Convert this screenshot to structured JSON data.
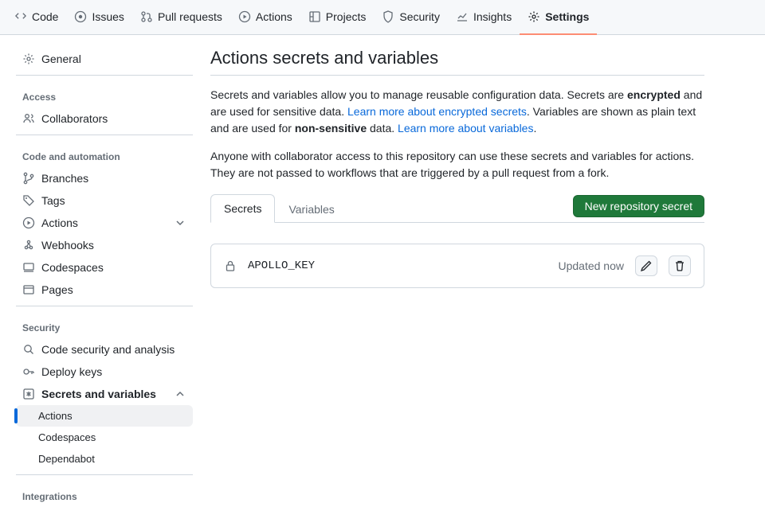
{
  "topnav": [
    {
      "label": "Code",
      "icon": "code"
    },
    {
      "label": "Issues",
      "icon": "issue"
    },
    {
      "label": "Pull requests",
      "icon": "pr"
    },
    {
      "label": "Actions",
      "icon": "play"
    },
    {
      "label": "Projects",
      "icon": "project"
    },
    {
      "label": "Security",
      "icon": "shield"
    },
    {
      "label": "Insights",
      "icon": "graph"
    },
    {
      "label": "Settings",
      "icon": "gear",
      "active": true
    }
  ],
  "sidebar": {
    "general": "General",
    "access_heading": "Access",
    "collaborators": "Collaborators",
    "code_heading": "Code and automation",
    "branches": "Branches",
    "tags": "Tags",
    "actions": "Actions",
    "webhooks": "Webhooks",
    "codespaces": "Codespaces",
    "pages": "Pages",
    "security_heading": "Security",
    "codesec": "Code security and analysis",
    "deploy": "Deploy keys",
    "secrets": "Secrets and variables",
    "sv_actions": "Actions",
    "sv_codespaces": "Codespaces",
    "sv_dependabot": "Dependabot",
    "integrations_heading": "Integrations"
  },
  "page": {
    "title": "Actions secrets and variables",
    "p1a": "Secrets and variables allow you to manage reusable configuration data. Secrets are ",
    "p1b": "encrypted",
    "p1c": " and are used for sensitive data. ",
    "p1link1": "Learn more about encrypted secrets",
    "p1d": ". Variables are shown as plain text and are used for ",
    "p1e": "non-sensitive",
    "p1f": " data. ",
    "p1link2": "Learn more about variables",
    "p1g": ".",
    "p2": "Anyone with collaborator access to this repository can use these secrets and variables for actions. They are not passed to workflows that are triggered by a pull request from a fork.",
    "tab_secrets": "Secrets",
    "tab_variables": "Variables",
    "new_secret_btn": "New repository secret"
  },
  "secret": {
    "name": "APOLLO_KEY",
    "updated": "Updated now"
  }
}
